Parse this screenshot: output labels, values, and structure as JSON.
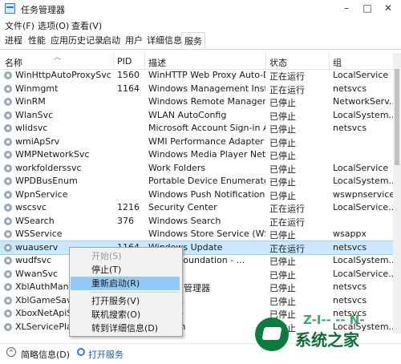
{
  "window": {
    "title": "任务管理器",
    "minimize": "–",
    "maximize": "□",
    "close": "✕"
  },
  "menu": [
    "文件(F)",
    "选项(O)",
    "查看(V)"
  ],
  "tabs": [
    "进程",
    "性能",
    "应用历史记录",
    "启动",
    "用户",
    "详细信息",
    "服务"
  ],
  "active_tab": "服务",
  "columns": {
    "name": "名称",
    "pid": "PID",
    "desc": "描述",
    "status": "状态",
    "group": "组"
  },
  "rows": [
    {
      "name": "WinHttpAutoProxySvc",
      "pid": "1560",
      "desc": "WinHTTP Web Proxy Auto-Dis...",
      "status": "正在运行",
      "group": "LocalService"
    },
    {
      "name": "Winmgmt",
      "pid": "1164",
      "desc": "Windows Management Instru...",
      "status": "正在运行",
      "group": "netsvcs"
    },
    {
      "name": "WinRM",
      "pid": "",
      "desc": "Windows Remote Manageme...",
      "status": "已停止",
      "group": "NetworkServ..."
    },
    {
      "name": "WlanSvc",
      "pid": "",
      "desc": "WLAN AutoConfig",
      "status": "已停止",
      "group": "LocalSystem..."
    },
    {
      "name": "wlidsvc",
      "pid": "",
      "desc": "Microsoft Account Sign-in As...",
      "status": "已停止",
      "group": "netsvcs"
    },
    {
      "name": "wmiApSrv",
      "pid": "",
      "desc": "WMI Performance Adapter",
      "status": "已停止",
      "group": ""
    },
    {
      "name": "WMPNetworkSvc",
      "pid": "",
      "desc": "Windows Media Player Netw...",
      "status": "已停止",
      "group": ""
    },
    {
      "name": "workfolderssvc",
      "pid": "",
      "desc": "Work Folders",
      "status": "已停止",
      "group": "LocalService"
    },
    {
      "name": "WPDBusEnum",
      "pid": "",
      "desc": "Portable Device Enumerator ...",
      "status": "已停止",
      "group": "LocalSystem..."
    },
    {
      "name": "WpnService",
      "pid": "",
      "desc": "Windows Push Notifications S...",
      "status": "已停止",
      "group": "wswpnservice"
    },
    {
      "name": "wscsvc",
      "pid": "1216",
      "desc": "Security Center",
      "status": "正在运行",
      "group": "LocalService..."
    },
    {
      "name": "WSearch",
      "pid": "376",
      "desc": "Windows Search",
      "status": "正在运行",
      "group": ""
    },
    {
      "name": "WSService",
      "pid": "",
      "desc": "Windows Store Service (WSS...",
      "status": "已停止",
      "group": "wsappx"
    },
    {
      "name": "wuauserv",
      "pid": "1164",
      "desc": "Windows Update",
      "status": "正在运行",
      "group": "netsvcs"
    },
    {
      "name": "wudfsvc",
      "pid": "",
      "desc": "Driver Foundation - ...",
      "status": "已停止",
      "group": "LocalSystem..."
    },
    {
      "name": "WwanSvc",
      "pid": "",
      "desc": "oConfig",
      "status": "已停止",
      "group": "LocalService..."
    },
    {
      "name": "XblAuthManage",
      "pid": "",
      "desc": "身份验证管理器",
      "status": "已停止",
      "group": "netsvcs"
    },
    {
      "name": "XblGameSave",
      "pid": "",
      "desc": "游戏保存",
      "status": "已停止",
      "group": "netsvcs"
    },
    {
      "name": "XboxNetApiSvc",
      "pid": "",
      "desc": "网络服务",
      "status": "已停止",
      "group": "netsvcs"
    },
    {
      "name": "XLServicePlatfo",
      "pid": "",
      "desc": "Platform",
      "status": "已停止",
      "group": "LocalSystem..."
    }
  ],
  "context_menu": [
    "开始(S)",
    "停止(T)",
    "重新启动(R)",
    "打开服务(V)",
    "联机搜索(O)",
    "转到详细信息(D)"
  ],
  "footer": {
    "fewer_details": "简略信息(D)",
    "open_services": "打开服务"
  },
  "watermark": {
    "text": "系统之家",
    "partial": "Z-I-- -- N-"
  }
}
